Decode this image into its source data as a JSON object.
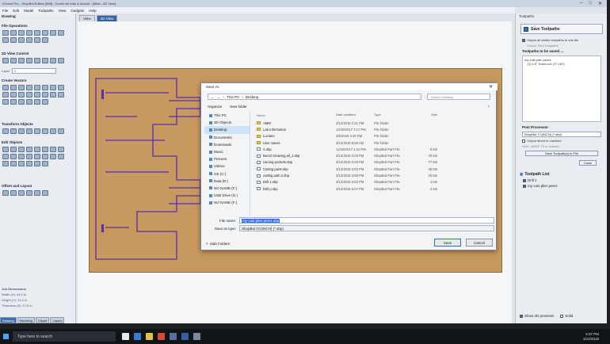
{
  "app": {
    "title": "VCarve Pro - ShopBot Edition [5Mf] - Centro for Kids & Alumni - [Meta - 2D View]",
    "menu": [
      "File",
      "Edit",
      "Model",
      "Toolpaths",
      "View",
      "Gadgets",
      "Help"
    ]
  },
  "left_panel": {
    "header": "Drawing",
    "sections": [
      "File Operations",
      "2D View Control",
      "Create Vectors",
      "Transform Objects",
      "Edit Objects",
      "Offset and Layout"
    ],
    "layer_label": "Layer",
    "layer_value": "0",
    "dimensions_title": "Job Dimensions",
    "width": "Width (X): 24.0 in",
    "height": "Height (Y): 12.0 in",
    "thickness": "Thickness (Z): 0.75 in",
    "bottom_tabs": [
      "Drawing",
      "Modeling",
      "Clipart",
      "Layers"
    ]
  },
  "view_tabs": [
    "View",
    "2D View"
  ],
  "right_panel": {
    "title": "Toolpaths",
    "save_button": "Save Toolpaths",
    "opt_visible": "Output all visible toolpaths to one file",
    "opt_visible_checked": true,
    "opt_visible_hint": "Output Tiled Toolpaths",
    "to_be_saved_label": "Toolpaths to be saved ...",
    "saved_list": [
      "my cuts plier perez",
      "[1] 1/4\" Down-cut (17.187)"
    ],
    "post_processor_label": "Post Processor",
    "post_processor_value": "ShopBot TC(INCH) (*.sbp)",
    "direct_to_machine": "Output direct to machine",
    "direct_to_machine_checked": false,
    "machine_hint": "Note: (WIN2 TS in Inches)",
    "save_to_file_button": "Save Toolpath(s) to File",
    "close_button": "Close",
    "toolpath_list_title": "Toolpath List",
    "toolpaths": [
      "Drill 1",
      "my cuts plier perez"
    ],
    "toolpaths_checked": [
      true,
      true
    ],
    "show_2d_previews": "Show 2D previews",
    "show_2d_previews_checked": true,
    "solid": "Solid",
    "solid_checked": false
  },
  "dialog": {
    "title": "Save As",
    "breadcrumb": [
      "This PC",
      "Desktop"
    ],
    "search_placeholder": "Search Desktop",
    "organize": "Organize",
    "new_folder": "New folder",
    "nav": [
      "This PC",
      "3D Objects",
      "Desktop",
      "Documents",
      "Downloads",
      "Music",
      "Pictures",
      "Videos",
      "OS (C:)",
      "Data (E:)",
      "NO NAME (F:)",
      "USB Drive (G:)",
      "NO NAME (F:)"
    ],
    "nav_selected": 2,
    "columns": [
      "Name",
      "Date modified",
      "Type",
      "Size"
    ],
    "files": [
      {
        "name": "AMM",
        "date": "3/12/2018 2:21 PM",
        "type": "File folder",
        "size": "",
        "folder": true
      },
      {
        "name": "Lab Information",
        "date": "12/16/2017 7:17 PM",
        "type": "File folder",
        "size": "",
        "folder": true
      },
      {
        "name": "Luciano",
        "date": "3/5/2018 4:28 PM",
        "type": "File folder",
        "size": "",
        "folder": true
      },
      {
        "name": "User Saves",
        "date": "3/12/2018 8:56 AM",
        "type": "File folder",
        "size": "",
        "folder": true
      },
      {
        "name": "A.sbp",
        "date": "12/16/2017 1:21 PM",
        "type": "ShopBot Part File",
        "size": "5 KB",
        "folder": false
      },
      {
        "name": "Bench Drawing all_1.sbp",
        "date": "3/12/2018 3:03 PM",
        "type": "ShopBot Part File",
        "size": "75 KB",
        "folder": false
      },
      {
        "name": "carving pockets.sbp",
        "date": "3/12/2018 3:03 PM",
        "type": "ShopBot Part File",
        "size": "77 KB",
        "folder": false
      },
      {
        "name": "Cutting parts.sbp",
        "date": "3/12/2018 3:03 PM",
        "type": "ShopBot Part File",
        "size": "45 KB",
        "folder": false
      },
      {
        "name": "cutting path 2.sbp",
        "date": "3/12/2018 3:58 PM",
        "type": "ShopBot Part File",
        "size": "19 KB",
        "folder": false
      },
      {
        "name": "Drill 1.sbp",
        "date": "3/12/2018 3:03 PM",
        "type": "ShopBot Part File",
        "size": "4 KB",
        "folder": false
      },
      {
        "name": "Drill p.sbp",
        "date": "3/12/2018 6:07 PM",
        "type": "ShopBot Part File",
        "size": "3 KB",
        "folder": false
      }
    ],
    "file_name_label": "File name:",
    "file_name_value": "my cuts pilar perez.sbp",
    "save_type_label": "Save as type:",
    "save_type_value": "ShopBot TC(INCH) (*.sbp)",
    "hide_folders": "Hide Folders",
    "save_button": "Save",
    "cancel_button": "Cancel"
  },
  "taskbar": {
    "search_placeholder": "Type here to search",
    "time": "6:37 PM",
    "date": "3/12/2018"
  }
}
